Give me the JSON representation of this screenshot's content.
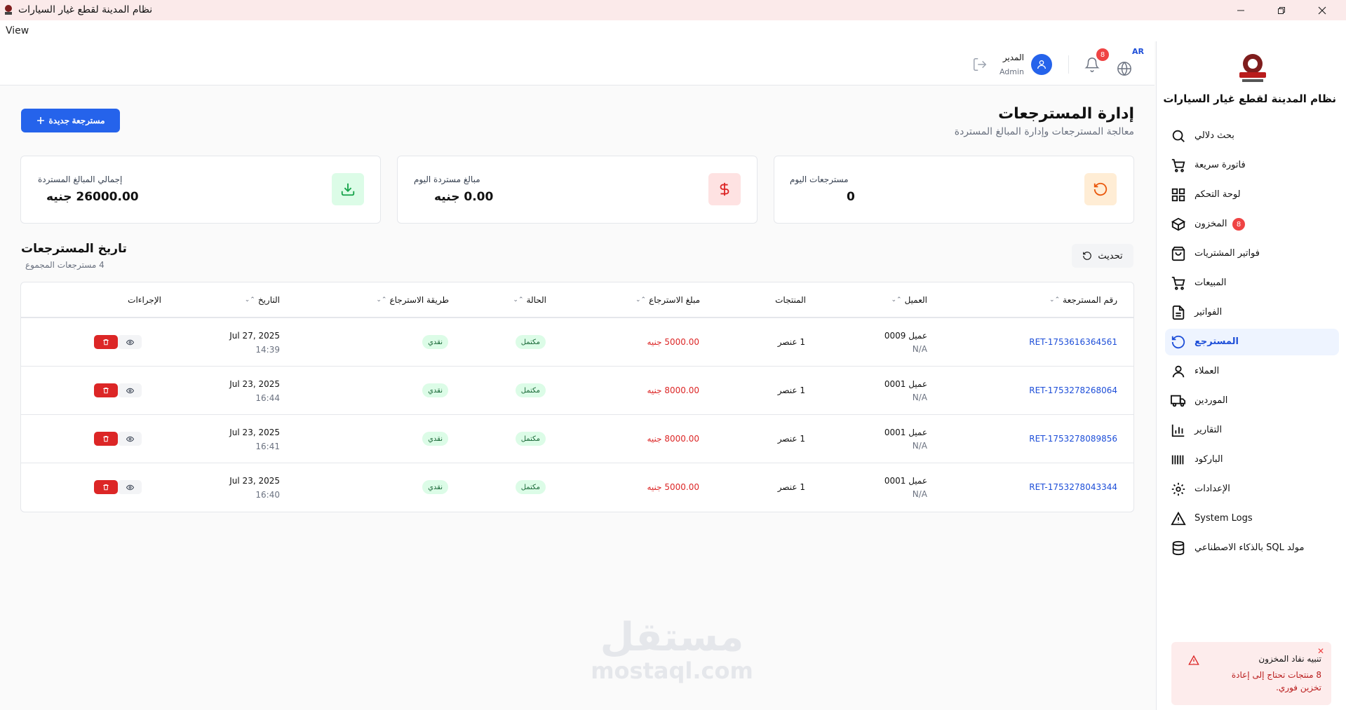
{
  "window": {
    "title": "نظام المدينة لقطع غيار السيارات",
    "menu_view": "View"
  },
  "sidebar": {
    "brand": "نظام المدينة لقطع غيار السيارات",
    "items": [
      {
        "label": "بحث دلالي",
        "icon": "search-icon"
      },
      {
        "label": "فاتورة سريعة",
        "icon": "cart-icon"
      },
      {
        "label": "لوحة التحكم",
        "icon": "dashboard-icon"
      },
      {
        "label": "المخزون",
        "icon": "box-icon",
        "badge": "8"
      },
      {
        "label": "فواتير المشتريات",
        "icon": "shopping-bag-icon"
      },
      {
        "label": "المبيعات",
        "icon": "cart-icon"
      },
      {
        "label": "الفواتير",
        "icon": "file-icon"
      },
      {
        "label": "المسترجع",
        "icon": "rotate-ccw-icon",
        "active": true
      },
      {
        "label": "العملاء",
        "icon": "user-icon"
      },
      {
        "label": "الموردين",
        "icon": "truck-icon"
      },
      {
        "label": "التقارير",
        "icon": "bar-chart-icon"
      },
      {
        "label": "الباركود",
        "icon": "barcode-icon"
      },
      {
        "label": "الإعدادات",
        "icon": "gear-icon"
      },
      {
        "label": "System Logs",
        "icon": "warning-icon"
      },
      {
        "label": "مولد SQL بالذكاء الاصطناعي",
        "icon": "database-icon"
      }
    ]
  },
  "toast": {
    "title": "تنبيه نفاد المخزون",
    "message": "8 منتجات تحتاج إلى إعادة تخزين فوري."
  },
  "header": {
    "lang": "AR",
    "notifications": "8",
    "user_name": "المدير",
    "user_role": "Admin"
  },
  "page": {
    "title": "إدارة المسترجعات",
    "subtitle": "معالجة المسترجعات وإدارة المبالغ المستردة",
    "new_button": "مسترجعة جديدة"
  },
  "stats": [
    {
      "label": "مسترجعات اليوم",
      "value": "0",
      "color": "#ea580c"
    },
    {
      "label": "مبالغ مستردة اليوم",
      "value": "0.00 جنيه",
      "color": "#dc2626"
    },
    {
      "label": "إجمالي المبالغ المستردة",
      "value": "26000.00 جنيه",
      "color": "#16a34a"
    }
  ],
  "history": {
    "title": "تاريخ المسترجعات",
    "count": "4 مسترجعات المجموع",
    "refresh": "تحديث"
  },
  "table": {
    "columns": [
      "رقم المسترجعة",
      "العميل",
      "المنتجات",
      "مبلغ الاسترجاع",
      "الحالة",
      "طريقة الاسترجاع",
      "التاريخ",
      "الإجراءات"
    ],
    "rows": [
      {
        "id": "RET-1753616364561",
        "customer": "عميل 0009",
        "customer_sub": "N/A",
        "products": "1 عنصر",
        "amount": "5000.00 جنيه",
        "status": "مكتمل",
        "method": "نقدي",
        "date": "Jul 27, 2025",
        "time": "14:39"
      },
      {
        "id": "RET-1753278268064",
        "customer": "عميل 0001",
        "customer_sub": "N/A",
        "products": "1 عنصر",
        "amount": "8000.00 جنيه",
        "status": "مكتمل",
        "method": "نقدي",
        "date": "Jul 23, 2025",
        "time": "16:44"
      },
      {
        "id": "RET-1753278089856",
        "customer": "عميل 0001",
        "customer_sub": "N/A",
        "products": "1 عنصر",
        "amount": "8000.00 جنيه",
        "status": "مكتمل",
        "method": "نقدي",
        "date": "Jul 23, 2025",
        "time": "16:41"
      },
      {
        "id": "RET-1753278043344",
        "customer": "عميل 0001",
        "customer_sub": "N/A",
        "products": "1 عنصر",
        "amount": "5000.00 جنيه",
        "status": "مكتمل",
        "method": "نقدي",
        "date": "Jul 23, 2025",
        "time": "16:40"
      }
    ]
  },
  "watermark": {
    "ar": "مستقل",
    "en": "mostaql.com"
  }
}
